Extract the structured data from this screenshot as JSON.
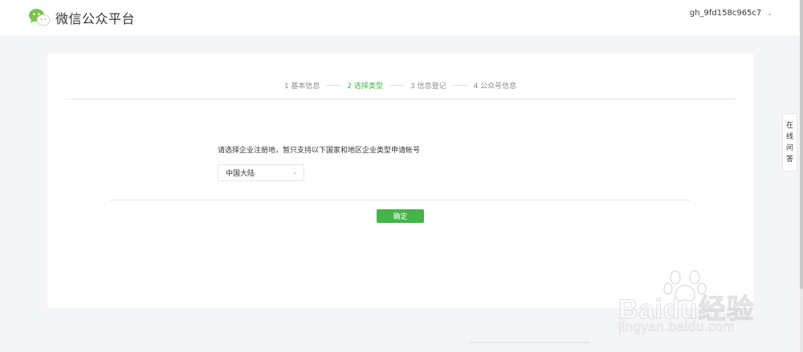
{
  "header": {
    "brand_title": "微信公众平台",
    "account_name": "gh_9fd158c965c7",
    "account_caret": "⌄"
  },
  "steps": [
    {
      "label": "1 基本信息",
      "active": false
    },
    {
      "label": "2 选择类型",
      "active": true
    },
    {
      "label": "3 信息登记",
      "active": false
    },
    {
      "label": "4 公众号信息",
      "active": false
    }
  ],
  "form": {
    "question": "请选择企业注册地，暂只支持以下国家和地区企业类型申请帐号",
    "region_select_value": "中国大陆",
    "confirm_label": "确定"
  },
  "side_tab": {
    "chars": [
      "在",
      "线",
      "问",
      "答"
    ]
  },
  "watermark": {
    "main": "Baidu经验",
    "sub": "jingyan.baidu.com"
  },
  "colors": {
    "accent": "#44b549",
    "page_bg": "#f4f5f9",
    "text": "#353535",
    "muted": "#8d8d8d"
  },
  "icons": {
    "logo": "wechat-logo-icon",
    "caret": "chevron-down-icon",
    "select_arrow": "chevron-down-icon"
  }
}
